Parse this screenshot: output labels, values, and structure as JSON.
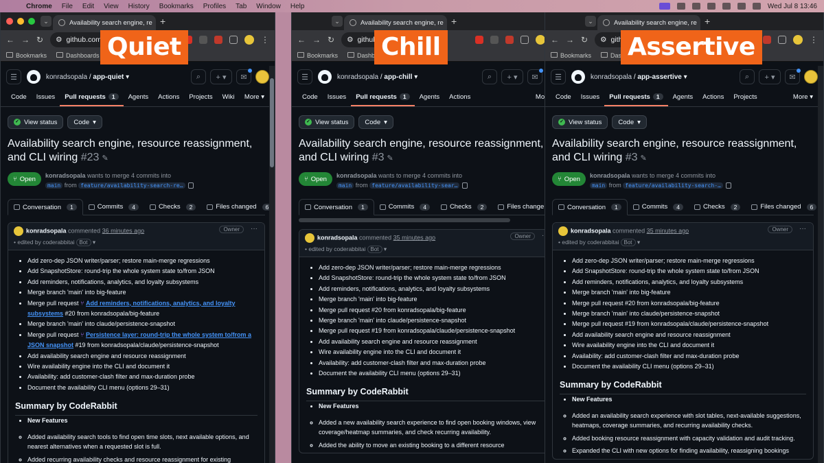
{
  "menubar": {
    "app": "Chrome",
    "items": [
      "File",
      "Edit",
      "View",
      "History",
      "Bookmarks",
      "Profiles",
      "Tab",
      "Window",
      "Help"
    ],
    "clock": "Wed Jul 8 13:46"
  },
  "shared": {
    "tab_title": "Availability search engine, re",
    "url": "github.com",
    "bookmarks": [
      "Bookmarks",
      "Dashboards"
    ],
    "owner": "konradsopala",
    "view_status": "View status",
    "code_btn": "Code",
    "open": "Open",
    "merge_text": "wants to merge 4 commits into",
    "base_branch": "main",
    "from": "from",
    "commented": "commented",
    "owner_tag": "Owner",
    "edited_by": "• edited by coderabbitai",
    "bot": "Bot",
    "summary_heading": "Summary by CodeRabbit",
    "new_features": "New Features",
    "more": "More"
  },
  "panels": [
    {
      "label": "Quiet",
      "repo": "app-quiet",
      "nav": [
        {
          "label": "Code"
        },
        {
          "label": "Issues"
        },
        {
          "label": "Pull requests",
          "count": "1",
          "active": true
        },
        {
          "label": "Agents"
        },
        {
          "label": "Actions"
        },
        {
          "label": "Projects"
        },
        {
          "label": "Wiki"
        }
      ],
      "title": "Availability search engine, resource reassignment, and CLI wiring",
      "number": "#23",
      "head_branch": "feature/availability-search-re…",
      "tabs": [
        {
          "label": "Conversation",
          "count": "1"
        },
        {
          "label": "Commits",
          "count": "4"
        },
        {
          "label": "Checks",
          "count": "2"
        },
        {
          "label": "Files changed",
          "count": "6"
        }
      ],
      "ago": "36 minutes ago",
      "commits": [
        "Add zero-dep JSON writer/parser; restore main-merge regressions",
        "Add SnapshotStore: round-trip the whole system state to/from JSON",
        "Add reminders, notifications, analytics, and loyalty subsystems",
        "Merge branch 'main' into big-feature",
        "Merge pull request",
        "Merge branch 'main' into claude/persistence-snapshot",
        "Merge pull request",
        "Add availability search engine and resource reassignment",
        "Wire availability engine into the CLI and document it",
        "Availability: add customer-clash filter and max-duration probe",
        "Document the availability CLI menu (options 29–31)"
      ],
      "pr_link_1": "Add reminders, notifications, analytics, and loyalty subsystems",
      "pr_tail_1": "#20 from konradsopala/big-feature",
      "pr_link_2": "Persistence layer: round-trip the whole system to/from a JSON snapshot",
      "pr_tail_2": "#19 from konradsopala/claude/persistence-snapshot",
      "features": [
        "Added availability search tools to find open time slots, next available options, and nearest alternatives when a requested slot is full.",
        "Added recurring availability checks and resource reassignment for existing bookings."
      ]
    },
    {
      "label": "Chill",
      "repo": "app-chill",
      "nav": [
        {
          "label": "Code"
        },
        {
          "label": "Issues"
        },
        {
          "label": "Pull requests",
          "count": "1",
          "active": true
        },
        {
          "label": "Agents"
        },
        {
          "label": "Actions"
        }
      ],
      "title": "Availability search engine, resource reassignment, and CLI wiring",
      "number": "#3",
      "head_branch": "feature/availability-sear…",
      "tabs": [
        {
          "label": "Conversation",
          "count": "1"
        },
        {
          "label": "Commits",
          "count": "4"
        },
        {
          "label": "Checks",
          "count": "2"
        },
        {
          "label": "Files change",
          "count": ""
        }
      ],
      "ago": "35 minutes ago",
      "commits": [
        "Add zero-dep JSON writer/parser; restore main-merge regressions",
        "Add SnapshotStore: round-trip the whole system state to/from JSON",
        "Add reminders, notifications, analytics, and loyalty subsystems",
        "Merge branch 'main' into big-feature",
        "Merge pull request #20 from konradsopala/big-feature",
        "Merge branch 'main' into claude/persistence-snapshot",
        "Merge pull request #19 from konradsopala/claude/persistence-snapshot",
        "Add availability search engine and resource reassignment",
        "Wire availability engine into the CLI and document it",
        "Availability: add customer-clash filter and max-duration probe",
        "Document the availability CLI menu (options 29–31)"
      ],
      "features": [
        "Added a new availability search experience to find open booking windows, view coverage/heatmap summaries, and check recurring availability.",
        "Added the ability to move an existing booking to a different resource"
      ]
    },
    {
      "label": "Assertive",
      "repo": "app-assertive",
      "nav": [
        {
          "label": "Code"
        },
        {
          "label": "Issues"
        },
        {
          "label": "Pull requests",
          "count": "1",
          "active": true
        },
        {
          "label": "Agents"
        },
        {
          "label": "Actions"
        },
        {
          "label": "Projects"
        }
      ],
      "title": "Availability search engine, resource reassignment, and CLI wiring",
      "number": "#3",
      "head_branch": "feature/availability-search-…",
      "tabs": [
        {
          "label": "Conversation",
          "count": "1"
        },
        {
          "label": "Commits",
          "count": "4"
        },
        {
          "label": "Checks",
          "count": "2"
        },
        {
          "label": "Files changed",
          "count": "6"
        }
      ],
      "ago": "35 minutes ago",
      "commits": [
        "Add zero-dep JSON writer/parser; restore main-merge regressions",
        "Add SnapshotStore: round-trip the whole system state to/from JSON",
        "Add reminders, notifications, analytics, and loyalty subsystems",
        "Merge branch 'main' into big-feature",
        "Merge pull request #20 from konradsopala/big-feature",
        "Merge branch 'main' into claude/persistence-snapshot",
        "Merge pull request #19 from konradsopala/claude/persistence-snapshot",
        "Add availability search engine and resource reassignment",
        "Wire availability engine into the CLI and document it",
        "Availability: add customer-clash filter and max-duration probe",
        "Document the availability CLI menu (options 29–31)"
      ],
      "features": [
        "Added an availability search experience with slot tables, next-available suggestions, heatmaps, coverage summaries, and recurring availability checks.",
        "Added booking resource reassignment with capacity validation and audit tracking.",
        "Expanded the CLI with new options for finding availability, reassigning bookings"
      ]
    }
  ]
}
